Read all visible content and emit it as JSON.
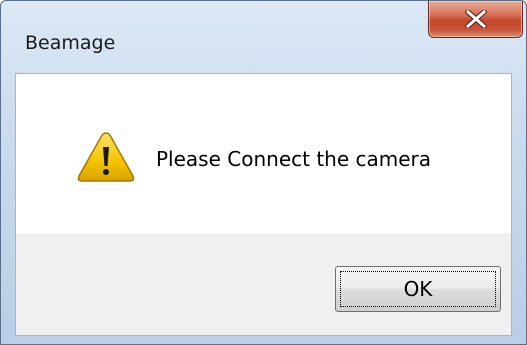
{
  "window": {
    "title": "Beamage",
    "close_label": "x"
  },
  "dialog": {
    "icon": "warning-icon",
    "message": "Please Connect the camera",
    "ok_label": "OK"
  },
  "colors": {
    "close_button": "#c4472c",
    "frame": "#c9dbee",
    "footer": "#f0f0f0",
    "warning_yellow": "#f5c400"
  }
}
